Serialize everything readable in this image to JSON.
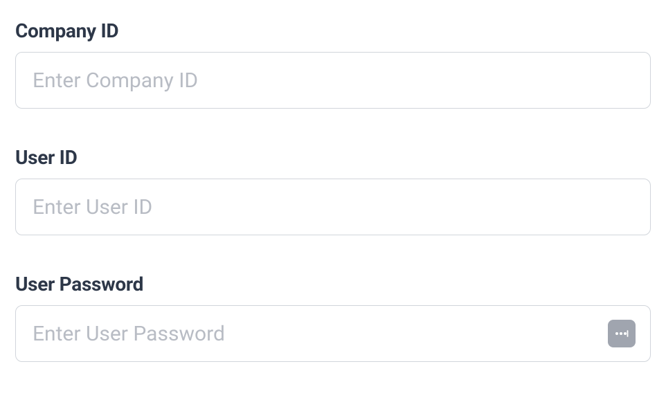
{
  "form": {
    "company_id": {
      "label": "Company ID",
      "placeholder": "Enter Company ID",
      "value": ""
    },
    "user_id": {
      "label": "User ID",
      "placeholder": "Enter User ID",
      "value": ""
    },
    "user_password": {
      "label": "User Password",
      "placeholder": "Enter User Password",
      "value": ""
    }
  }
}
